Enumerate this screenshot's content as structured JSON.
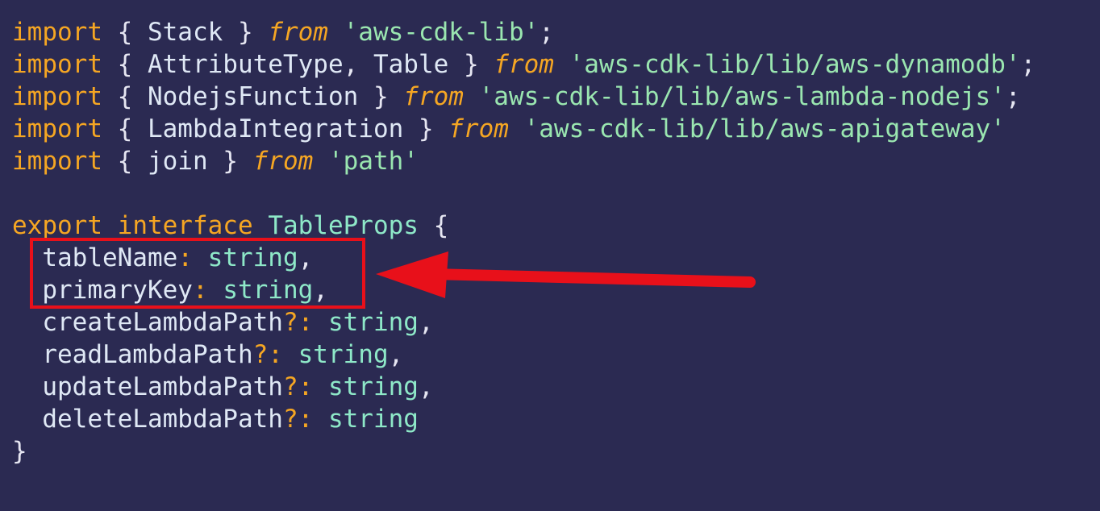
{
  "editor": {
    "lines": [
      [
        {
          "t": "import",
          "c": "kw"
        },
        {
          "t": " { ",
          "c": "pn"
        },
        {
          "t": "Stack",
          "c": "id"
        },
        {
          "t": " } ",
          "c": "pn"
        },
        {
          "t": "from",
          "c": "it"
        },
        {
          "t": " ",
          "c": "pn"
        },
        {
          "t": "'aws-cdk-lib'",
          "c": "str"
        },
        {
          "t": ";",
          "c": "pn"
        }
      ],
      [
        {
          "t": "import",
          "c": "kw"
        },
        {
          "t": " { ",
          "c": "pn"
        },
        {
          "t": "AttributeType",
          "c": "id"
        },
        {
          "t": ", ",
          "c": "pn"
        },
        {
          "t": "Table",
          "c": "id"
        },
        {
          "t": " } ",
          "c": "pn"
        },
        {
          "t": "from",
          "c": "it"
        },
        {
          "t": " ",
          "c": "pn"
        },
        {
          "t": "'aws-cdk-lib/lib/aws-dynamodb'",
          "c": "str"
        },
        {
          "t": ";",
          "c": "pn"
        }
      ],
      [
        {
          "t": "import",
          "c": "kw"
        },
        {
          "t": " { ",
          "c": "pn"
        },
        {
          "t": "NodejsFunction",
          "c": "id"
        },
        {
          "t": " } ",
          "c": "pn"
        },
        {
          "t": "from",
          "c": "it"
        },
        {
          "t": " ",
          "c": "pn"
        },
        {
          "t": "'aws-cdk-lib/lib/aws-lambda-nodejs'",
          "c": "str"
        },
        {
          "t": ";",
          "c": "pn"
        }
      ],
      [
        {
          "t": "import",
          "c": "kw"
        },
        {
          "t": " { ",
          "c": "pn"
        },
        {
          "t": "LambdaIntegration",
          "c": "id"
        },
        {
          "t": " } ",
          "c": "pn"
        },
        {
          "t": "from",
          "c": "it"
        },
        {
          "t": " ",
          "c": "pn"
        },
        {
          "t": "'aws-cdk-lib/lib/aws-apigateway'",
          "c": "str"
        }
      ],
      [
        {
          "t": "import",
          "c": "kw"
        },
        {
          "t": " { ",
          "c": "pn"
        },
        {
          "t": "join",
          "c": "id"
        },
        {
          "t": " } ",
          "c": "pn"
        },
        {
          "t": "from",
          "c": "it"
        },
        {
          "t": " ",
          "c": "pn"
        },
        {
          "t": "'path'",
          "c": "str"
        }
      ],
      [],
      [
        {
          "t": "export",
          "c": "kw"
        },
        {
          "t": " ",
          "c": "pn"
        },
        {
          "t": "interface",
          "c": "kw"
        },
        {
          "t": " ",
          "c": "pn"
        },
        {
          "t": "TableProps",
          "c": "ty"
        },
        {
          "t": " {",
          "c": "pn"
        }
      ],
      [
        {
          "t": "  ",
          "c": "pn"
        },
        {
          "t": "tableName",
          "c": "id"
        },
        {
          "t": ":",
          "c": "op"
        },
        {
          "t": " ",
          "c": "pn"
        },
        {
          "t": "string",
          "c": "ty"
        },
        {
          "t": ",",
          "c": "pn"
        }
      ],
      [
        {
          "t": "  ",
          "c": "pn"
        },
        {
          "t": "primaryKey",
          "c": "id"
        },
        {
          "t": ":",
          "c": "op"
        },
        {
          "t": " ",
          "c": "pn"
        },
        {
          "t": "string",
          "c": "ty"
        },
        {
          "t": ",",
          "c": "pn"
        }
      ],
      [
        {
          "t": "  ",
          "c": "pn"
        },
        {
          "t": "createLambdaPath",
          "c": "id"
        },
        {
          "t": "?:",
          "c": "op"
        },
        {
          "t": " ",
          "c": "pn"
        },
        {
          "t": "string",
          "c": "ty"
        },
        {
          "t": ",",
          "c": "pn"
        }
      ],
      [
        {
          "t": "  ",
          "c": "pn"
        },
        {
          "t": "readLambdaPath",
          "c": "id"
        },
        {
          "t": "?:",
          "c": "op"
        },
        {
          "t": " ",
          "c": "pn"
        },
        {
          "t": "string",
          "c": "ty"
        },
        {
          "t": ",",
          "c": "pn"
        }
      ],
      [
        {
          "t": "  ",
          "c": "pn"
        },
        {
          "t": "updateLambdaPath",
          "c": "id"
        },
        {
          "t": "?:",
          "c": "op"
        },
        {
          "t": " ",
          "c": "pn"
        },
        {
          "t": "string",
          "c": "ty"
        },
        {
          "t": ",",
          "c": "pn"
        }
      ],
      [
        {
          "t": "  ",
          "c": "pn"
        },
        {
          "t": "deleteLambdaPath",
          "c": "id"
        },
        {
          "t": "?:",
          "c": "op"
        },
        {
          "t": " ",
          "c": "pn"
        },
        {
          "t": "string",
          "c": "ty"
        }
      ],
      [
        {
          "t": "}",
          "c": "pn"
        }
      ]
    ]
  },
  "annotation": {
    "box_color": "#e8101a",
    "arrow_color": "#e8101a"
  },
  "theme": {
    "background": "#2b2a52",
    "keyword": "#f5a623",
    "string": "#9ae6b0",
    "type": "#8ee8c8"
  }
}
